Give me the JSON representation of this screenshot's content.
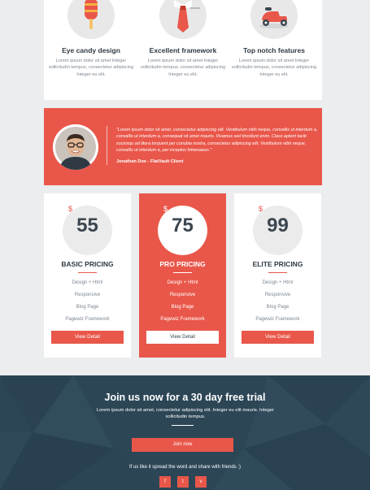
{
  "features": [
    {
      "icon": "popsicle-icon",
      "title": "Eye candy design",
      "text": "Lorem ipsum dolor sit amet Integer sollicitudin tempus, consectetur adipiscing Integer eu elit."
    },
    {
      "icon": "necktie-icon",
      "title": "Excellent framework",
      "text": "Lorem ipsum dolor sit amet Integer sollicitudin tempus, consectetur adipiscing Integer eu elit."
    },
    {
      "icon": "scooter-icon",
      "title": "Top notch features",
      "text": "Lorem ipsum dolor sit amet Integer sollicitudin tempus, consectetur adipiscing Integer eu elit."
    }
  ],
  "testimonial": {
    "quote": "\"Lorem ipsum dolor sit amet, consectetur adipiscing elit. Vestibulum nibh neque, convallis ut interdum a, convallis ut interdum a, consequat sit amet mauris. Vivamus sed tincidunt enim. Class aptent taciti sociosqu ad litora torquent per conubia nostra, consectetur adipiscing elit. Vestibulum nibh neque, convallis ut interdum a, per inceptos himenaeos.\"",
    "author": "Jonathan Doe - FlatVault Client"
  },
  "pricing": [
    {
      "currency": "$",
      "price": "55",
      "name": "BASIC PRICING",
      "items": [
        "Design + Html",
        "Responsive",
        "Blog Page",
        "Pagewiz Framework"
      ],
      "button": "View Detail"
    },
    {
      "currency": "$",
      "price": "75",
      "name": "PRO PRICING",
      "items": [
        "Design + Html",
        "Responsive",
        "Blog Page",
        "Pagewiz Framework"
      ],
      "button": "View Detail"
    },
    {
      "currency": "$",
      "price": "99",
      "name": "ELITE PRICING",
      "items": [
        "Design + Html",
        "Responsive",
        "Blog Page",
        "Pagewiz Framework"
      ],
      "button": "View Detail"
    }
  ],
  "footer": {
    "title": "Join us now for a 30 day free trial",
    "text": "Lorem ipsum dolor sit amet, consectetur adipiscing elit. Integer eu elit mauris. Integer sollicitudin tempus.",
    "button": "Join now",
    "share": "If us like it spread the word and share with friends :)",
    "social": [
      "f",
      "t",
      "v"
    ]
  },
  "colors": {
    "accent": "#e9574a",
    "dark": "#2d4656",
    "text": "#3b4650",
    "muted": "#7d8791",
    "bg": "#ebedee"
  }
}
